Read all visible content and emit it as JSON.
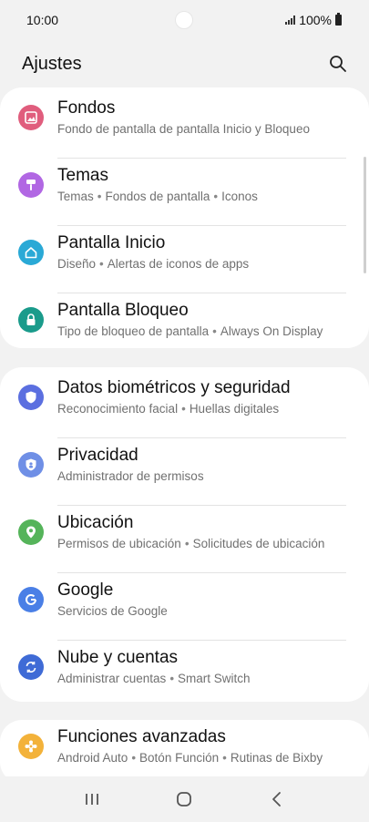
{
  "status": {
    "time": "10:00",
    "battery": "100%"
  },
  "header": {
    "title": "Ajustes",
    "search_icon": "search-icon"
  },
  "groups": [
    {
      "items": [
        {
          "title": "Fondos",
          "subtitle": [
            "Fondo de pantalla de pantalla Inicio y Bloqueo"
          ],
          "icon": "image-icon",
          "color": "#e05d7d"
        },
        {
          "title": "Temas",
          "subtitle": [
            "Temas",
            "Fondos de pantalla",
            "Iconos"
          ],
          "icon": "brush-icon",
          "color": "#b167e3"
        },
        {
          "title": "Pantalla Inicio",
          "subtitle": [
            "Diseño",
            "Alertas de iconos de apps"
          ],
          "icon": "home-icon",
          "color": "#2aa9d6"
        },
        {
          "title": "Pantalla Bloqueo",
          "subtitle": [
            "Tipo de bloqueo de pantalla",
            "Always On Display"
          ],
          "icon": "lock-icon",
          "color": "#1a9b8b"
        }
      ]
    },
    {
      "items": [
        {
          "title": "Datos biométricos y seguridad",
          "subtitle": [
            "Reconocimiento facial",
            "Huellas digitales"
          ],
          "icon": "shield-icon",
          "color": "#5b6fe0"
        },
        {
          "title": "Privacidad",
          "subtitle": [
            "Administrador de permisos"
          ],
          "icon": "privacy-shield-icon",
          "color": "#6f8fe6"
        },
        {
          "title": "Ubicación",
          "subtitle": [
            "Permisos de ubicación",
            "Solicitudes de ubicación"
          ],
          "icon": "location-pin-icon",
          "color": "#55b45a"
        },
        {
          "title": "Google",
          "subtitle": [
            "Servicios de Google"
          ],
          "icon": "google-icon",
          "color": "#4a7fe6"
        },
        {
          "title": "Nube y cuentas",
          "subtitle": [
            "Administrar cuentas",
            "Smart Switch"
          ],
          "icon": "sync-icon",
          "color": "#3f6bd6"
        }
      ]
    },
    {
      "items": [
        {
          "title": "Funciones avanzadas",
          "subtitle": [
            "Android Auto",
            "Botón Función",
            "Rutinas de Bixby"
          ],
          "icon": "advanced-features-icon",
          "color": "#f3b23a"
        }
      ]
    }
  ],
  "nav": {
    "recents_icon": "recents-icon",
    "home_icon": "home-button-icon",
    "back_icon": "back-icon"
  }
}
